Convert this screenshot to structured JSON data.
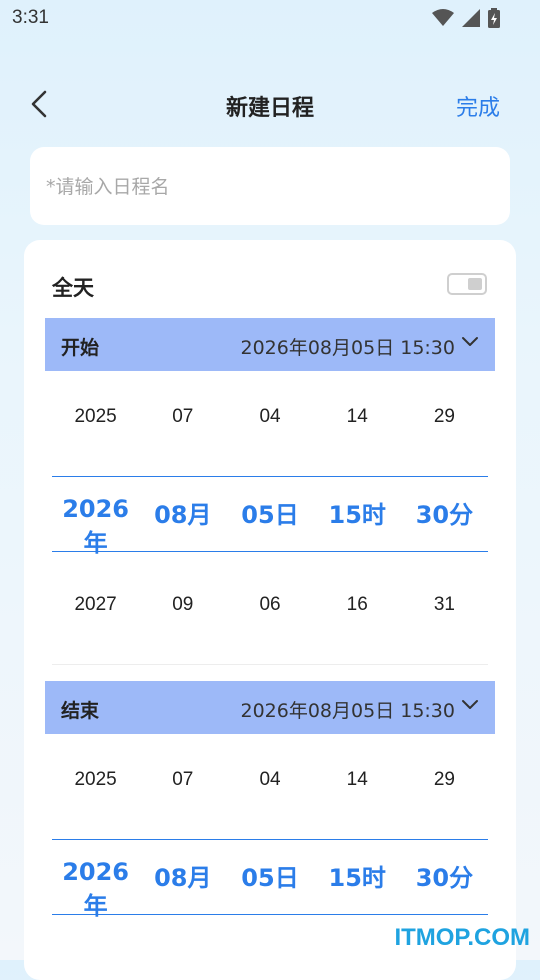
{
  "status_bar": {
    "time": "3:31",
    "icons": [
      "wifi-icon",
      "signal-icon",
      "battery-icon"
    ]
  },
  "header": {
    "title": "新建日程",
    "done_label": "完成",
    "back_icon": "back-chevron-icon"
  },
  "name_input": {
    "placeholder": "*请输入日程名",
    "value": ""
  },
  "all_day": {
    "label": "全天",
    "enabled": false
  },
  "start": {
    "label": "开始",
    "value": "2026年08月05日 15:30",
    "picker": {
      "above": [
        "2025",
        "07",
        "04",
        "14",
        "29"
      ],
      "selected": [
        "2026年",
        "08月",
        "05日",
        "15时",
        "30分"
      ],
      "below": [
        "2027",
        "09",
        "06",
        "16",
        "31"
      ]
    }
  },
  "end": {
    "label": "结束",
    "value": "2026年08月05日 15:30",
    "picker": {
      "above": [
        "2025",
        "07",
        "04",
        "14",
        "29"
      ],
      "selected": [
        "2026年",
        "08月",
        "05日",
        "15时",
        "30分"
      ]
    }
  },
  "watermark": "ITMOP.COM",
  "colors": {
    "accent": "#2b7de9",
    "section_bar": "#9db9f8",
    "card": "#ffffff",
    "watermark": "#1fa3e0"
  }
}
